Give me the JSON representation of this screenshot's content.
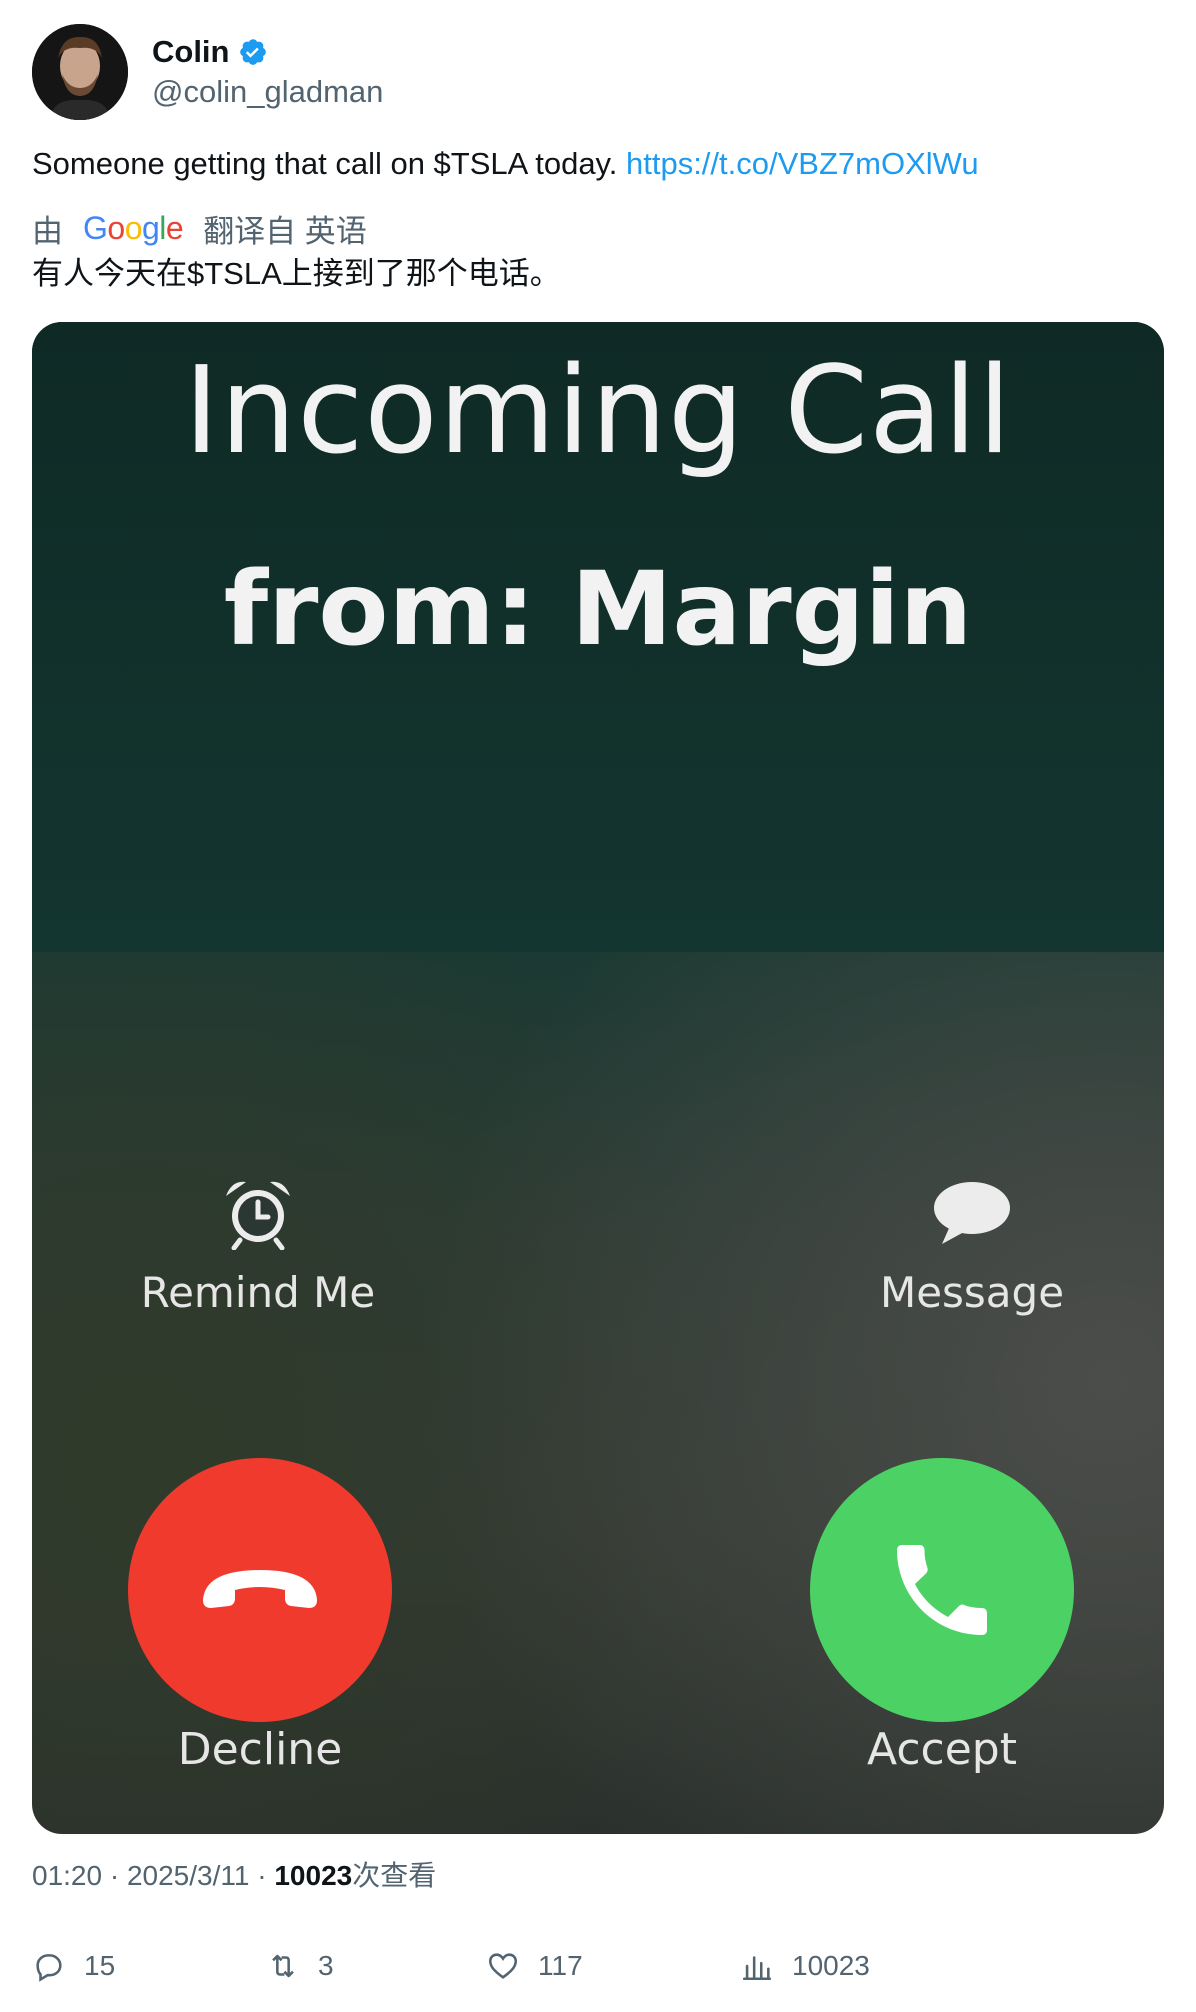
{
  "author": {
    "display_name": "Colin",
    "handle": "@colin_gladman",
    "verified": true
  },
  "tweet": {
    "text": "Someone getting that call on $TSLA today. ",
    "link": "https://t.co/VBZ7mOXlWu"
  },
  "translation": {
    "prefix": "由",
    "provider": "Google",
    "suffix": "翻译自 英语",
    "text": "有人今天在$TSLA上接到了那个电话。"
  },
  "media": {
    "title_line1": "Incoming  Call",
    "title_line2": "from: Margin",
    "remind_label": "Remind Me",
    "message_label": "Message",
    "decline_label": "Decline",
    "accept_label": "Accept",
    "decline_color": "#f13a2e",
    "accept_color": "#4cd264"
  },
  "meta": {
    "time": "01:20",
    "sep1": " · ",
    "date": "2025/3/11",
    "sep2": " · ",
    "views": "10023",
    "views_suffix": "次查看"
  },
  "actions": {
    "replies": "15",
    "retweets": "3",
    "likes": "117",
    "views": "10023"
  },
  "colors": {
    "link": "#1d9bf0",
    "muted": "#536471",
    "verified": "#1d9bf0"
  }
}
